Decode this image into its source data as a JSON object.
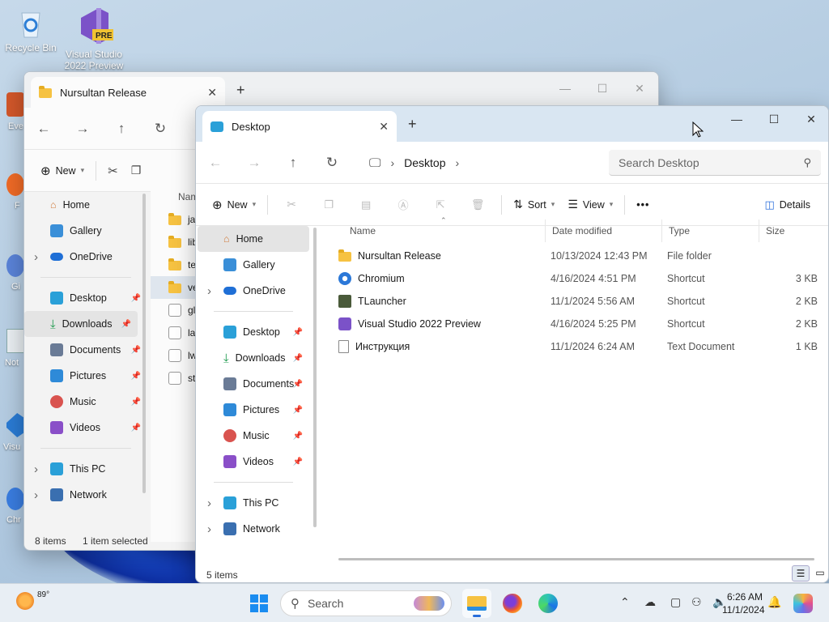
{
  "desktop": {
    "icons": [
      {
        "label": "Recycle Bin",
        "icon": "recycle-bin-icon"
      },
      {
        "label": "Visual Studio 2022 Preview",
        "icon": "visual-studio-icon",
        "badge": "PRE"
      }
    ],
    "edge_labels": [
      "Eve",
      "F",
      "Gi",
      "Not",
      "Visu",
      "Chr"
    ]
  },
  "back_window": {
    "tab_title": "Nursultan Release",
    "new_tab": "+",
    "controls": {
      "minimize": "—",
      "maximize": "☐",
      "close": "✕"
    },
    "nav": {
      "back": "←",
      "forward": "→",
      "up": "↑",
      "refresh": "↻"
    },
    "commands": {
      "new": "New"
    },
    "sidebar": {
      "top": [
        {
          "label": "Home",
          "icon": "home-icon"
        },
        {
          "label": "Gallery",
          "icon": "gallery-icon"
        },
        {
          "label": "OneDrive",
          "icon": "onedrive-icon",
          "expandable": true
        }
      ],
      "pinned": [
        {
          "label": "Desktop",
          "icon": "desktop-icon"
        },
        {
          "label": "Downloads",
          "icon": "downloads-icon",
          "selected": true
        },
        {
          "label": "Documents",
          "icon": "documents-icon"
        },
        {
          "label": "Pictures",
          "icon": "pictures-icon"
        },
        {
          "label": "Music",
          "icon": "music-icon"
        },
        {
          "label": "Videos",
          "icon": "videos-icon"
        }
      ],
      "bottom": [
        {
          "label": "This PC",
          "icon": "this-pc-icon"
        },
        {
          "label": "Network",
          "icon": "network-icon"
        }
      ]
    },
    "list_header": "Nam",
    "items": [
      "jav",
      "lib",
      "ten",
      "ver",
      "glf",
      "lat",
      "lwj",
      "sta"
    ],
    "status": {
      "count": "8 items",
      "selected": "1 item selected"
    }
  },
  "front_window": {
    "tab_title": "Desktop",
    "new_tab": "+",
    "controls": {
      "minimize": "—",
      "maximize": "☐",
      "close": "✕"
    },
    "nav": {
      "back": "←",
      "forward": "→",
      "up": "↑",
      "refresh": "↻"
    },
    "address": {
      "crumb": "Desktop",
      "sep": "›"
    },
    "search": {
      "placeholder": "Search Desktop"
    },
    "commands": {
      "new": "New",
      "sort": "Sort",
      "view": "View",
      "more": "•••",
      "details": "Details"
    },
    "sidebar": {
      "top": [
        {
          "label": "Home",
          "icon": "home-icon",
          "selected": true
        },
        {
          "label": "Gallery",
          "icon": "gallery-icon"
        },
        {
          "label": "OneDrive",
          "icon": "onedrive-icon",
          "expandable": true
        }
      ],
      "pinned": [
        {
          "label": "Desktop",
          "icon": "desktop-icon"
        },
        {
          "label": "Downloads",
          "icon": "downloads-icon"
        },
        {
          "label": "Documents",
          "icon": "documents-icon"
        },
        {
          "label": "Pictures",
          "icon": "pictures-icon"
        },
        {
          "label": "Music",
          "icon": "music-icon"
        },
        {
          "label": "Videos",
          "icon": "videos-icon"
        }
      ],
      "bottom": [
        {
          "label": "This PC",
          "icon": "this-pc-icon"
        },
        {
          "label": "Network",
          "icon": "network-icon"
        }
      ]
    },
    "columns": [
      "Name",
      "Date modified",
      "Type",
      "Size"
    ],
    "files": [
      {
        "name": "Nursultan Release",
        "date": "10/13/2024 12:43 PM",
        "type": "File folder",
        "size": "",
        "icon": "folder-icon"
      },
      {
        "name": "Chromium",
        "date": "4/16/2024 4:51 PM",
        "type": "Shortcut",
        "size": "3 KB",
        "icon": "chromium-icon"
      },
      {
        "name": "TLauncher",
        "date": "11/1/2024 5:56 AM",
        "type": "Shortcut",
        "size": "2 KB",
        "icon": "tlauncher-icon"
      },
      {
        "name": "Visual Studio 2022 Preview",
        "date": "4/16/2024 5:25 PM",
        "type": "Shortcut",
        "size": "2 KB",
        "icon": "visual-studio-icon"
      },
      {
        "name": "Инструкция",
        "date": "11/1/2024 6:24 AM",
        "type": "Text Document",
        "size": "1 KB",
        "icon": "text-document-icon"
      }
    ],
    "status": {
      "count": "5 items"
    }
  },
  "taskbar": {
    "weather": {
      "temp": "89°"
    },
    "search_placeholder": "Search",
    "time": "6:26 AM",
    "date": "11/1/2024"
  },
  "colors": {
    "accent": "#2a6edb",
    "folder": "#f6c242",
    "selection": "#e4e4e4"
  }
}
